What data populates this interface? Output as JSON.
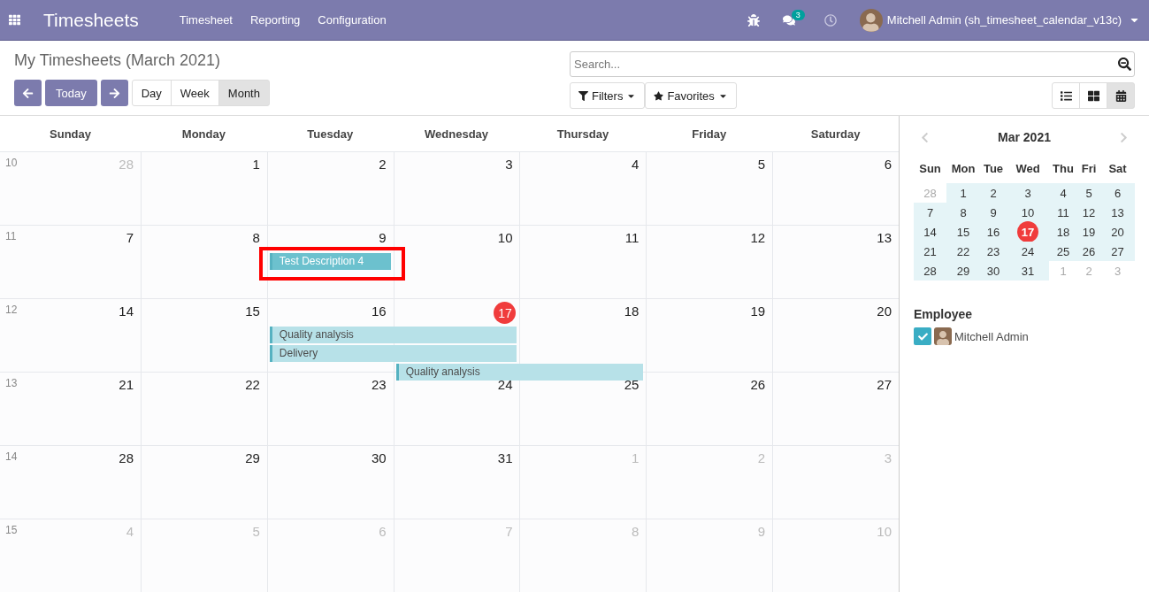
{
  "navbar": {
    "app_title": "Timesheets",
    "menu": [
      "Timesheet",
      "Reporting",
      "Configuration"
    ],
    "messages_badge": "3",
    "user": "Mitchell Admin (sh_timesheet_calendar_v13c)"
  },
  "control_panel": {
    "title": "My Timesheets (March 2021)",
    "today_button": "Today",
    "scales": [
      {
        "label": "Day",
        "selected": false
      },
      {
        "label": "Week",
        "selected": false
      },
      {
        "label": "Month",
        "selected": true
      }
    ],
    "search": {
      "placeholder": "Search..."
    },
    "filters": "Filters",
    "favorites": "Favorites",
    "views": [
      {
        "kind": "list",
        "selected": false
      },
      {
        "kind": "kanban",
        "selected": false
      },
      {
        "kind": "calendar",
        "selected": true
      }
    ]
  },
  "calendar": {
    "weekdays": [
      "Sunday",
      "Monday",
      "Tuesday",
      "Wednesday",
      "Thursday",
      "Friday",
      "Saturday"
    ],
    "weeks": [
      {
        "number": "10",
        "days": [
          {
            "label": "28",
            "in_month": false,
            "today": false
          },
          {
            "label": "1",
            "in_month": true,
            "today": false
          },
          {
            "label": "2",
            "in_month": true,
            "today": false
          },
          {
            "label": "3",
            "in_month": true,
            "today": false
          },
          {
            "label": "4",
            "in_month": true,
            "today": false
          },
          {
            "label": "5",
            "in_month": true,
            "today": false
          },
          {
            "label": "6",
            "in_month": true,
            "today": false
          }
        ]
      },
      {
        "number": "11",
        "days": [
          {
            "label": "7",
            "in_month": true,
            "today": false
          },
          {
            "label": "8",
            "in_month": true,
            "today": false
          },
          {
            "label": "9",
            "in_month": true,
            "today": false,
            "events": [
              {
                "title": "Test Description 4",
                "kind": "single_day",
                "selected": true,
                "annotated": true
              }
            ]
          },
          {
            "label": "10",
            "in_month": true,
            "today": false
          },
          {
            "label": "11",
            "in_month": true,
            "today": false
          },
          {
            "label": "12",
            "in_month": true,
            "today": false
          },
          {
            "label": "13",
            "in_month": true,
            "today": false
          }
        ]
      },
      {
        "number": "12",
        "days": [
          {
            "label": "14",
            "in_month": true,
            "today": false
          },
          {
            "label": "15",
            "in_month": true,
            "today": false
          },
          {
            "label": "16",
            "in_month": true,
            "today": false,
            "events": [
              {
                "title": "Quality analysis",
                "kind": "two_day",
                "selected": false,
                "annotated": false
              },
              {
                "title": "Delivery",
                "kind": "two_day",
                "selected": false,
                "annotated": false
              }
            ]
          },
          {
            "label": "17",
            "in_month": true,
            "today": true,
            "events": [
              {
                "title": "Quality analysis",
                "kind": "two_day",
                "selected": false,
                "annotated": false
              }
            ]
          },
          {
            "label": "18",
            "in_month": true,
            "today": false
          },
          {
            "label": "19",
            "in_month": true,
            "today": false
          },
          {
            "label": "20",
            "in_month": true,
            "today": false
          }
        ]
      },
      {
        "number": "13",
        "days": [
          {
            "label": "21",
            "in_month": true,
            "today": false
          },
          {
            "label": "22",
            "in_month": true,
            "today": false
          },
          {
            "label": "23",
            "in_month": true,
            "today": false
          },
          {
            "label": "24",
            "in_month": true,
            "today": false
          },
          {
            "label": "25",
            "in_month": true,
            "today": false
          },
          {
            "label": "26",
            "in_month": true,
            "today": false
          },
          {
            "label": "27",
            "in_month": true,
            "today": false
          }
        ]
      },
      {
        "number": "14",
        "days": [
          {
            "label": "28",
            "in_month": true,
            "today": false
          },
          {
            "label": "29",
            "in_month": true,
            "today": false
          },
          {
            "label": "30",
            "in_month": true,
            "today": false
          },
          {
            "label": "31",
            "in_month": true,
            "today": false
          },
          {
            "label": "1",
            "in_month": false,
            "today": false
          },
          {
            "label": "2",
            "in_month": false,
            "today": false
          },
          {
            "label": "3",
            "in_month": false,
            "today": false
          }
        ]
      },
      {
        "number": "15",
        "days": [
          {
            "label": "4",
            "in_month": false,
            "today": false
          },
          {
            "label": "5",
            "in_month": false,
            "today": false
          },
          {
            "label": "6",
            "in_month": false,
            "today": false
          },
          {
            "label": "7",
            "in_month": false,
            "today": false
          },
          {
            "label": "8",
            "in_month": false,
            "today": false
          },
          {
            "label": "9",
            "in_month": false,
            "today": false
          },
          {
            "label": "10",
            "in_month": false,
            "today": false
          }
        ]
      }
    ]
  },
  "mini_calendar": {
    "title": "Mar 2021",
    "weekdays": [
      "Sun",
      "Mon",
      "Tue",
      "Wed",
      "Thu",
      "Fri",
      "Sat"
    ],
    "weeks": [
      [
        {
          "label": "28",
          "in_month": false,
          "today": false
        },
        {
          "label": "1",
          "in_month": true,
          "today": false
        },
        {
          "label": "2",
          "in_month": true,
          "today": false
        },
        {
          "label": "3",
          "in_month": true,
          "today": false
        },
        {
          "label": "4",
          "in_month": true,
          "today": false
        },
        {
          "label": "5",
          "in_month": true,
          "today": false
        },
        {
          "label": "6",
          "in_month": true,
          "today": false
        }
      ],
      [
        {
          "label": "7",
          "in_month": true,
          "today": false
        },
        {
          "label": "8",
          "in_month": true,
          "today": false
        },
        {
          "label": "9",
          "in_month": true,
          "today": false
        },
        {
          "label": "10",
          "in_month": true,
          "today": false
        },
        {
          "label": "11",
          "in_month": true,
          "today": false
        },
        {
          "label": "12",
          "in_month": true,
          "today": false
        },
        {
          "label": "13",
          "in_month": true,
          "today": false
        }
      ],
      [
        {
          "label": "14",
          "in_month": true,
          "today": false
        },
        {
          "label": "15",
          "in_month": true,
          "today": false
        },
        {
          "label": "16",
          "in_month": true,
          "today": false
        },
        {
          "label": "17",
          "in_month": true,
          "today": true
        },
        {
          "label": "18",
          "in_month": true,
          "today": false
        },
        {
          "label": "19",
          "in_month": true,
          "today": false
        },
        {
          "label": "20",
          "in_month": true,
          "today": false
        }
      ],
      [
        {
          "label": "21",
          "in_month": true,
          "today": false
        },
        {
          "label": "22",
          "in_month": true,
          "today": false
        },
        {
          "label": "23",
          "in_month": true,
          "today": false
        },
        {
          "label": "24",
          "in_month": true,
          "today": false
        },
        {
          "label": "25",
          "in_month": true,
          "today": false
        },
        {
          "label": "26",
          "in_month": true,
          "today": false
        },
        {
          "label": "27",
          "in_month": true,
          "today": false
        }
      ],
      [
        {
          "label": "28",
          "in_month": true,
          "today": false
        },
        {
          "label": "29",
          "in_month": true,
          "today": false
        },
        {
          "label": "30",
          "in_month": true,
          "today": false
        },
        {
          "label": "31",
          "in_month": true,
          "today": false
        },
        {
          "label": "1",
          "in_month": false,
          "today": false
        },
        {
          "label": "2",
          "in_month": false,
          "today": false
        },
        {
          "label": "3",
          "in_month": false,
          "today": false
        }
      ]
    ]
  },
  "employee_filter": {
    "title": "Employee",
    "items": [
      {
        "name": "Mitchell Admin",
        "checked": true
      }
    ]
  }
}
